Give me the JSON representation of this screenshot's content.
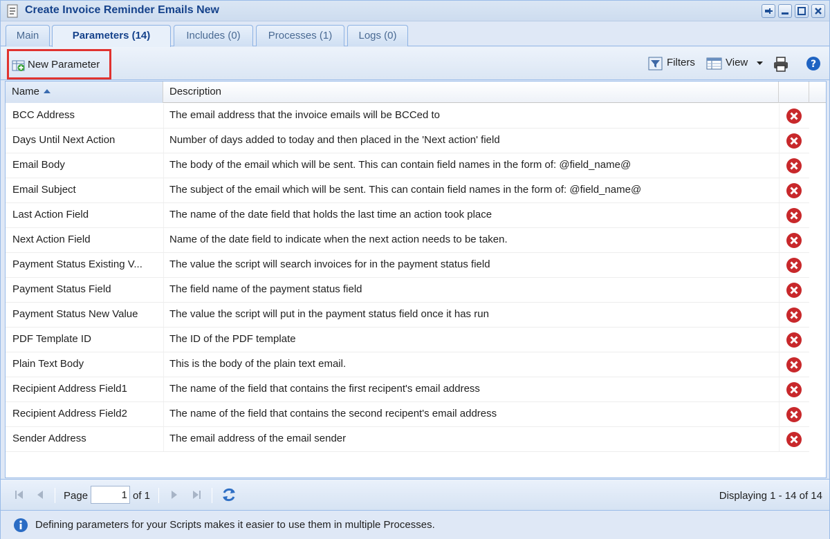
{
  "window": {
    "title": "Create Invoice Reminder Emails New"
  },
  "tabs": [
    {
      "label": "Main"
    },
    {
      "label": "Parameters (14)"
    },
    {
      "label": "Includes (0)"
    },
    {
      "label": "Processes (1)"
    },
    {
      "label": "Logs (0)"
    }
  ],
  "toolbar": {
    "new_parameter_label": "New Parameter",
    "filters_label": "Filters",
    "view_label": "View"
  },
  "grid": {
    "columns": [
      "Name",
      "Description"
    ],
    "rows": [
      {
        "name": "BCC Address",
        "description": "The email address that the invoice emails will be BCCed to"
      },
      {
        "name": "Days Until Next Action",
        "description": "Number of days added to today and then placed in the 'Next action' field"
      },
      {
        "name": "Email Body",
        "description": "The body of the email which will be sent. This can contain field names in the form of: @field_name@"
      },
      {
        "name": "Email Subject",
        "description": "The subject of the email which will be sent. This can contain field names in the form of: @field_name@"
      },
      {
        "name": "Last Action Field",
        "description": "The name of the date field that holds the last time an action took place"
      },
      {
        "name": "Next Action Field",
        "description": "Name of the date field to indicate when the next action needs to be taken."
      },
      {
        "name": "Payment Status Existing V...",
        "description": "The value the script will search invoices for in the payment status field"
      },
      {
        "name": "Payment Status Field",
        "description": "The field name of the payment status field"
      },
      {
        "name": "Payment Status New Value",
        "description": "The value the script will put in the payment status field once it has run"
      },
      {
        "name": "PDF Template ID",
        "description": "The ID of the PDF template"
      },
      {
        "name": "Plain Text Body",
        "description": "This is the body of the plain text email."
      },
      {
        "name": "Recipient Address Field1",
        "description": "The name of the field that contains the first recipent's email address"
      },
      {
        "name": "Recipient Address Field2",
        "description": "The name of the field that contains the second recipent's email address"
      },
      {
        "name": "Sender Address",
        "description": "The email address of the email sender"
      }
    ]
  },
  "paging": {
    "page_label": "Page",
    "page_value": "1",
    "of_label": "of 1",
    "display_info": "Displaying 1 - 14 of 14"
  },
  "info": {
    "text": "Defining parameters for your Scripts makes it easier to use them in multiple Processes."
  },
  "colors": {
    "accent": "#15428b",
    "highlight_border": "#e0322f",
    "delete_red": "#c8282b"
  }
}
